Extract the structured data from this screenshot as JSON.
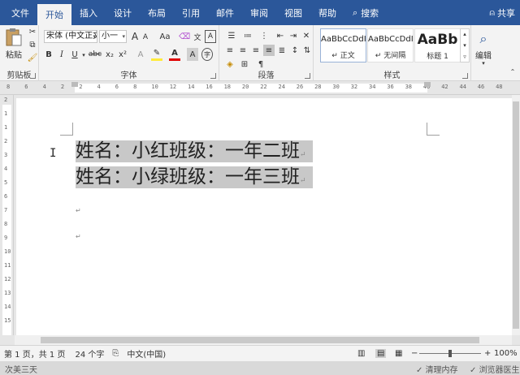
{
  "tabs": [
    {
      "label": "文件",
      "active": false
    },
    {
      "label": "开始",
      "active": true
    },
    {
      "label": "插入",
      "active": false
    },
    {
      "label": "设计",
      "active": false
    },
    {
      "label": "布局",
      "active": false
    },
    {
      "label": "引用",
      "active": false
    },
    {
      "label": "邮件",
      "active": false
    },
    {
      "label": "审阅",
      "active": false
    },
    {
      "label": "视图",
      "active": false
    },
    {
      "label": "帮助",
      "active": false
    }
  ],
  "search_label": "搜索",
  "share_label": "共享",
  "clipboard": {
    "paste_label": "粘贴",
    "group_label": "剪贴板"
  },
  "font": {
    "font_name": "宋体 (中文正文)",
    "font_size": "小一",
    "bold": "B",
    "italic": "I",
    "underline": "U",
    "strike": "abc",
    "subscript": "x₂",
    "superscript": "x²",
    "grow": "A",
    "shrink": "A",
    "change_case": "Aa",
    "group_label": "字体"
  },
  "paragraph": {
    "group_label": "段落"
  },
  "styles": {
    "items": [
      {
        "sample": "AaBbCcDdI",
        "name": "↵ 正文",
        "selected": true
      },
      {
        "sample": "AaBbCcDdI",
        "name": "↵ 无间隔",
        "selected": false
      },
      {
        "sample": "AaBb",
        "name": "标题 1",
        "selected": false
      }
    ],
    "group_label": "样式"
  },
  "editing": {
    "label": "编辑"
  },
  "ruler": {
    "h_ticks": [
      "8",
      "6",
      "4",
      "2",
      "2",
      "4",
      "6",
      "8",
      "10",
      "12",
      "14",
      "16",
      "18",
      "20",
      "22",
      "24",
      "26",
      "28",
      "30",
      "32",
      "34",
      "36",
      "38",
      "40",
      "42",
      "44",
      "46",
      "48"
    ],
    "v_ticks": [
      "2",
      "1",
      "1",
      "2",
      "3",
      "4",
      "5",
      "6",
      "7",
      "8",
      "9",
      "10",
      "11",
      "12",
      "13",
      "14",
      "15"
    ]
  },
  "document": {
    "lines": [
      "姓名：小红班级：一年二班",
      "姓名：小绿班级：一年三班"
    ],
    "paragraph_mark": "↵"
  },
  "status": {
    "page": "第 1 页，共 1 页",
    "words": "24 个字",
    "language": "中文(中国)",
    "zoom": "100%",
    "zoom_minus": "−",
    "zoom_plus": "+"
  },
  "taskbar": {
    "left_text": "次美三天",
    "right_items": [
      "清理内存",
      "浏览器医生"
    ]
  },
  "colors": {
    "accent": "#2b579a",
    "selection": "#c8c8c8",
    "highlight_yellow": "#ffeb3b",
    "font_red": "#e00000"
  }
}
